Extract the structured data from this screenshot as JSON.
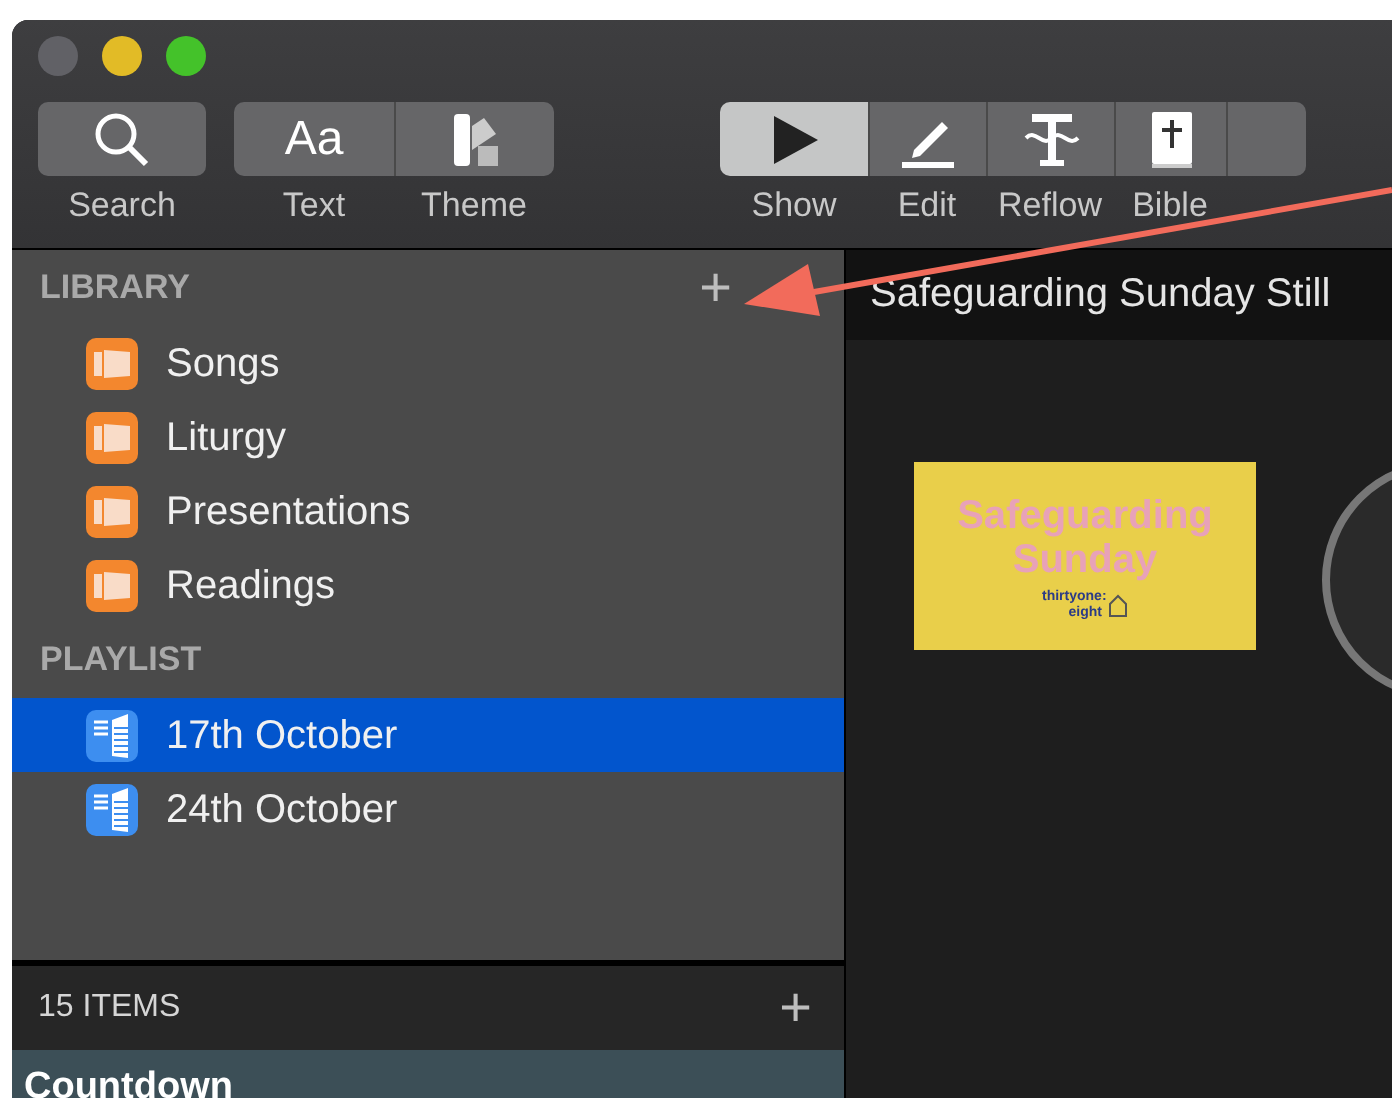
{
  "toolbar": {
    "groups": [
      {
        "items": [
          {
            "label": "Search",
            "kind": "search",
            "selected": false
          }
        ]
      },
      {
        "items": [
          {
            "label": "Text",
            "kind": "text",
            "glyph": "Aa",
            "selected": false
          },
          {
            "label": "Theme",
            "kind": "theme",
            "selected": false
          }
        ]
      },
      {
        "items": [
          {
            "label": "Show",
            "kind": "show",
            "selected": true
          },
          {
            "label": "Edit",
            "kind": "edit",
            "selected": false
          },
          {
            "label": "Reflow",
            "kind": "reflow",
            "selected": false
          },
          {
            "label": "Bible",
            "kind": "bible",
            "selected": false
          },
          {
            "kind": "blank",
            "selected": false
          }
        ]
      }
    ]
  },
  "sidebar": {
    "sections": [
      {
        "title": "LIBRARY",
        "add_button": "+",
        "items": [
          {
            "label": "Songs",
            "kind": "library",
            "selected": false
          },
          {
            "label": "Liturgy",
            "kind": "library",
            "selected": false
          },
          {
            "label": "Presentations",
            "kind": "library",
            "selected": false
          },
          {
            "label": "Readings",
            "kind": "library",
            "selected": false
          }
        ]
      },
      {
        "title": "PLAYLIST",
        "items": [
          {
            "label": "17th October",
            "kind": "playlist",
            "selected": true
          },
          {
            "label": "24th October",
            "kind": "playlist",
            "selected": false
          }
        ]
      }
    ],
    "footer": {
      "count": "15 ITEMS",
      "add_button": "+"
    },
    "list": [
      {
        "label": "Countdown"
      }
    ]
  },
  "main": {
    "title": "Safeguarding Sunday Still",
    "slide": {
      "heading": "Safeguarding Sunday",
      "logo": "thirtyone: eight"
    }
  }
}
